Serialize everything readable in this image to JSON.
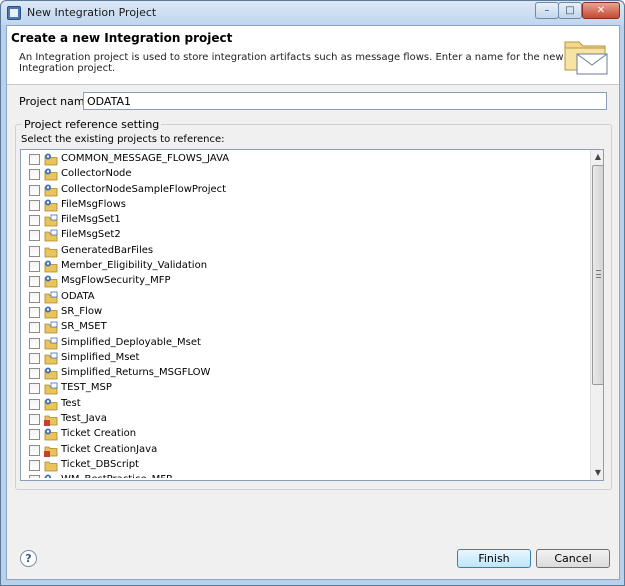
{
  "window": {
    "title": "New Integration Project",
    "minimize_glyph": "–",
    "maximize_glyph": "□",
    "close_glyph": "✕"
  },
  "header": {
    "title": "Create a new Integration project",
    "description": "An Integration project is used to store integration artifacts such as message flows. Enter a name for the new Integration project.",
    "icon": "envelope-folder-icon"
  },
  "project_name": {
    "label": "Project name:",
    "value": "ODATA1"
  },
  "reference": {
    "group_label": "Project reference setting",
    "instruction": "Select the existing projects to reference:",
    "items": [
      {
        "label": "COMMON_MESSAGE_FLOWS_JAVA",
        "icon": "integration-project-icon"
      },
      {
        "label": "CollectorNode",
        "icon": "integration-project-icon"
      },
      {
        "label": "CollectorNodeSampleFlowProject",
        "icon": "integration-project-icon"
      },
      {
        "label": "FileMsgFlows",
        "icon": "integration-project-icon"
      },
      {
        "label": "FileMsgSet1",
        "icon": "message-set-project-icon"
      },
      {
        "label": "FileMsgSet2",
        "icon": "message-set-project-icon"
      },
      {
        "label": "GeneratedBarFiles",
        "icon": "folder-icon"
      },
      {
        "label": "Member_Eligibility_Validation",
        "icon": "integration-project-icon"
      },
      {
        "label": "MsgFlowSecurity_MFP",
        "icon": "integration-project-icon"
      },
      {
        "label": "ODATA",
        "icon": "message-set-project-icon"
      },
      {
        "label": "SR_Flow",
        "icon": "integration-project-icon"
      },
      {
        "label": "SR_MSET",
        "icon": "message-set-project-icon"
      },
      {
        "label": "Simplified_Deployable_Mset",
        "icon": "message-set-project-icon"
      },
      {
        "label": "Simplified_Mset",
        "icon": "message-set-project-icon"
      },
      {
        "label": "Simplified_Returns_MSGFLOW",
        "icon": "integration-project-icon"
      },
      {
        "label": "TEST_MSP",
        "icon": "message-set-project-icon"
      },
      {
        "label": "Test",
        "icon": "integration-project-icon"
      },
      {
        "label": "Test_Java",
        "icon": "java-project-icon"
      },
      {
        "label": "Ticket Creation",
        "icon": "integration-project-icon"
      },
      {
        "label": "Ticket CreationJava",
        "icon": "java-project-icon"
      },
      {
        "label": "Ticket_DBScript",
        "icon": "folder-icon"
      },
      {
        "label": "WM_BestPractice_MFP",
        "icon": "integration-project-icon"
      }
    ]
  },
  "scrollbar": {
    "up_glyph": "▲",
    "down_glyph": "▼"
  },
  "footer": {
    "help_glyph": "?",
    "finish_label": "Finish",
    "cancel_label": "Cancel"
  },
  "colors": {
    "window_frame": "#b9d1ea",
    "dialog_background": "#f0f0f0",
    "folder_yellow": "#e8c45a",
    "project_blue": "#3e6fb6",
    "java_red": "#c8402b"
  }
}
